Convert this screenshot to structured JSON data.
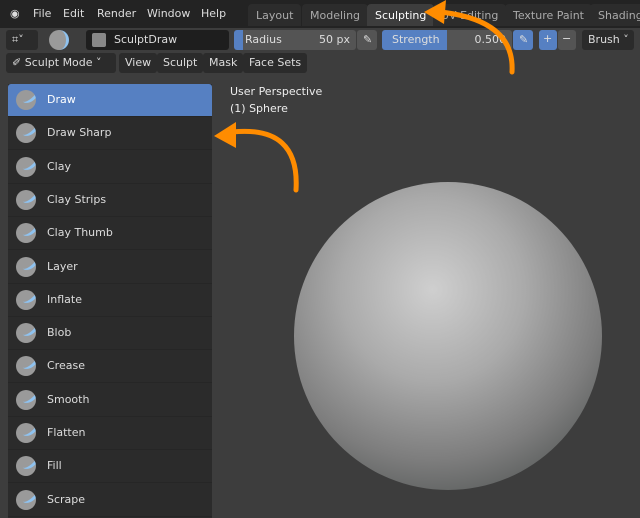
{
  "menu": [
    "File",
    "Edit",
    "Render",
    "Window",
    "Help"
  ],
  "tabs": [
    "Layout",
    "Modeling",
    "Sculpting",
    "UV Editing",
    "Texture Paint",
    "Shading"
  ],
  "active_tab": "Sculpting",
  "toolbar": {
    "brush_name": "SculptDraw",
    "radius_label": "Radius",
    "radius_value": "50 px",
    "strength_label": "Strength",
    "strength_value": "0.500",
    "strength_fraction": 0.5,
    "plus": "+",
    "minus": "−",
    "brush_menu": "Brush"
  },
  "header": {
    "mode": "Sculpt Mode",
    "menus": [
      "View",
      "Sculpt",
      "Mask",
      "Face Sets"
    ]
  },
  "viewport": {
    "perspective": "User Perspective",
    "object": "(1) Sphere"
  },
  "brushes": [
    "Draw",
    "Draw Sharp",
    "Clay",
    "Clay Strips",
    "Clay Thumb",
    "Layer",
    "Inflate",
    "Blob",
    "Crease",
    "Smooth",
    "Flatten",
    "Fill",
    "Scrape"
  ],
  "selected_brush": "Draw",
  "colors": {
    "accent": "#5680c2",
    "arrow": "#ff8c00"
  }
}
